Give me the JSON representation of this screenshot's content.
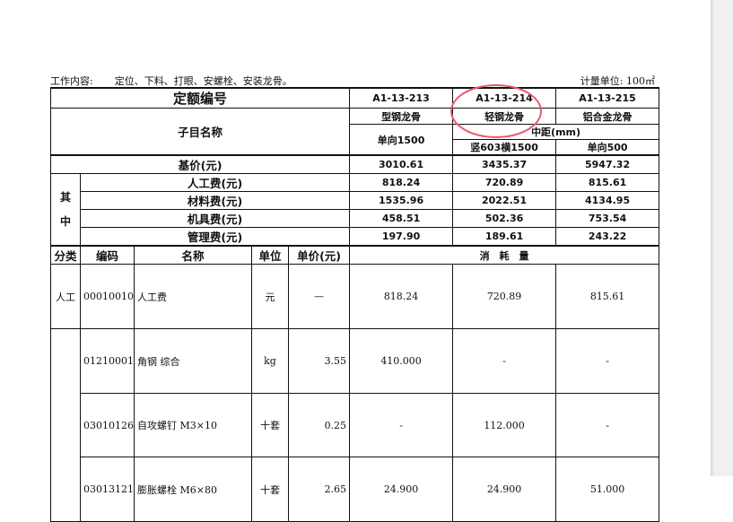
{
  "header": {
    "work_label": "工作内容:",
    "work_content": "定位、下料、打眼、安螺栓、安装龙骨。",
    "unit_label": "计量单位: 100㎡"
  },
  "table": {
    "quota_no_label": "定额编号",
    "codes": [
      "A1-13-213",
      "A1-13-214",
      "A1-13-215"
    ],
    "item_name_label": "子目名称",
    "types": [
      "型钢龙骨",
      "轻钢龙骨",
      "铝合金龙骨"
    ],
    "spacing_label": "中距(mm)",
    "specs": [
      "单向1500",
      "竖603横1500",
      "单向500"
    ],
    "base_price_label": "基价(元)",
    "base_prices": [
      "3010.61",
      "3435.37",
      "5947.32"
    ],
    "qizhong": [
      "其",
      "中"
    ],
    "breakdown": [
      {
        "label": "人工费(元)",
        "values": [
          "818.24",
          "720.89",
          "815.61"
        ]
      },
      {
        "label": "材料费(元)",
        "values": [
          "1535.96",
          "2022.51",
          "4134.95"
        ]
      },
      {
        "label": "机具费(元)",
        "values": [
          "458.51",
          "502.36",
          "753.54"
        ]
      },
      {
        "label": "管理费(元)",
        "values": [
          "197.90",
          "189.61",
          "243.22"
        ]
      }
    ],
    "col_headers": {
      "category": "分类",
      "code": "编码",
      "name": "名称",
      "unit": "单位",
      "price": "单价(元)",
      "consumption": "消　耗　量"
    },
    "rows": [
      {
        "category": "人工",
        "code": "00010010",
        "name": "人工费",
        "unit": "元",
        "price": "—",
        "values": [
          "818.24",
          "720.89",
          "815.61"
        ]
      },
      {
        "category": "",
        "code": "01210001",
        "name": "角钢 综合",
        "unit": "kg",
        "price": "3.55",
        "values": [
          "410.000",
          "-",
          "-"
        ]
      },
      {
        "category": "",
        "code": "03010126",
        "name": "自攻螺钉 M3×10",
        "unit": "十套",
        "price": "0.25",
        "values": [
          "-",
          "112.000",
          "-"
        ]
      },
      {
        "category": "",
        "code": "03013121",
        "name": "膨胀螺栓 M6×80",
        "unit": "十套",
        "price": "2.65",
        "values": [
          "24.900",
          "24.900",
          "51.000"
        ]
      }
    ]
  }
}
